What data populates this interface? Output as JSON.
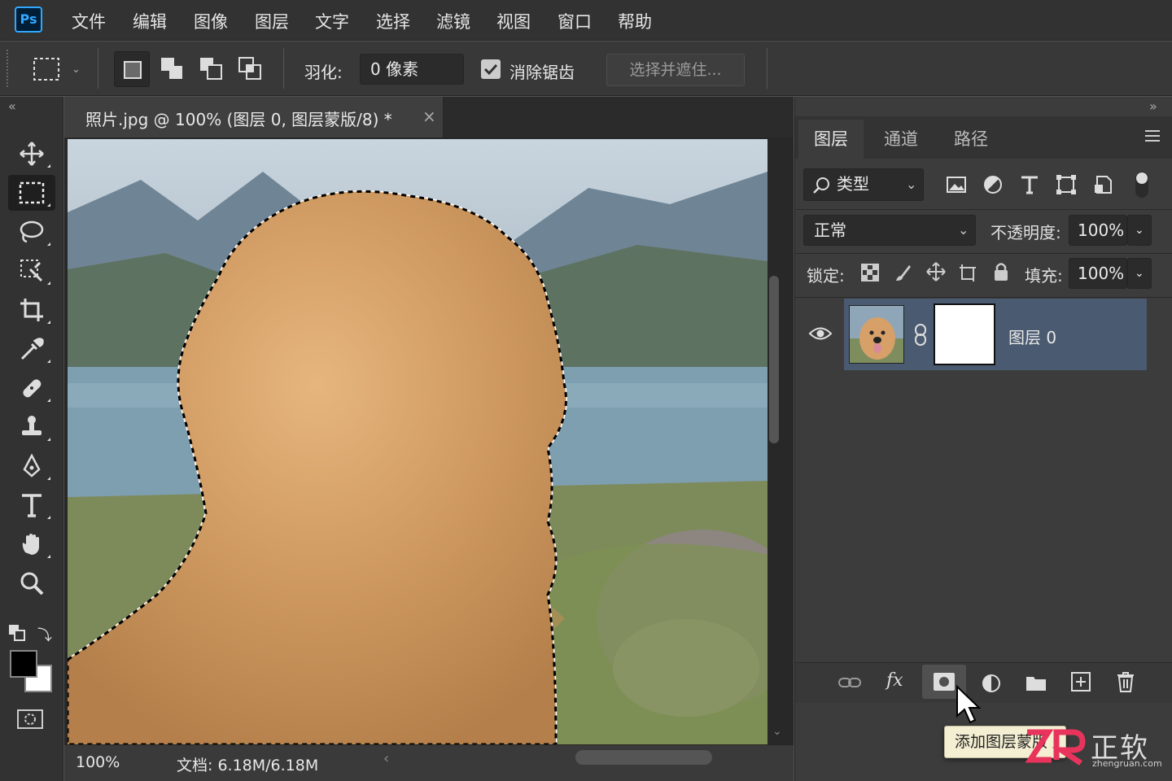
{
  "app": {
    "logo": "Ps"
  },
  "menu": [
    "文件",
    "编辑",
    "图像",
    "图层",
    "文字",
    "选择",
    "滤镜",
    "视图",
    "窗口",
    "帮助"
  ],
  "options": {
    "feather_label": "羽化:",
    "feather_value": "0 像素",
    "antialias_label": "消除锯齿",
    "antialias_checked": true,
    "select_mask_button": "选择并遮住..."
  },
  "toolbar": {
    "collapse_icon": "double-chevron-left",
    "tools": [
      "move",
      "rectangular-marquee",
      "lasso",
      "object-selection",
      "crop",
      "eyedropper",
      "healing-brush",
      "clone-stamp",
      "pen",
      "type",
      "hand",
      "zoom"
    ],
    "active_tool": "rectangular-marquee",
    "foreground_color": "#000000",
    "background_color": "#ffffff"
  },
  "document": {
    "tab_title": "照片.jpg @ 100% (图层 0, 图层蒙版/8) *",
    "close_glyph": "×"
  },
  "status": {
    "zoom": "100%",
    "doc_info": "文档: 6.18M/6.18M"
  },
  "layers_panel": {
    "tabs": [
      "图层",
      "通道",
      "路径"
    ],
    "active_tab": "图层",
    "filter_kind": "类型",
    "blend_mode": "正常",
    "opacity_label": "不透明度:",
    "opacity_value": "100%",
    "lock_label": "锁定:",
    "fill_label": "填充:",
    "fill_value": "100%",
    "layers": [
      {
        "name": "图层 0",
        "visible": true,
        "has_mask": true,
        "selected": true
      }
    ],
    "footer_icons": [
      "link-icon",
      "fx-icon",
      "add-mask-icon",
      "adjustment-icon",
      "folder-icon",
      "new-layer-icon",
      "trash-icon"
    ]
  },
  "tooltip": "添加图层蒙版",
  "watermark": {
    "brand": "正软",
    "site": "zhengruan.com"
  },
  "colors": {
    "panel_bg": "#3c3c3c",
    "selected_layer": "#4a5a70",
    "accent": "#31a8ff"
  }
}
